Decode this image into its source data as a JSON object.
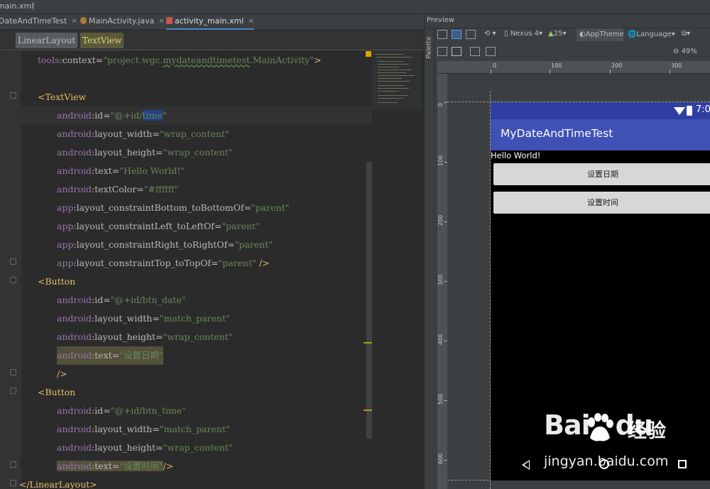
{
  "breadcrumb": {
    "file": "main.xml"
  },
  "tabs": [
    {
      "label": "DateAndTimeTest"
    },
    {
      "label": "MainActivity.java"
    },
    {
      "label": "activity_main.xml"
    }
  ],
  "xml_path": {
    "item1": "LinearLayout",
    "item2": "TextView"
  },
  "code": {
    "l0": {
      "ns": "tools",
      "attr": ":context=",
      "val": "\"project.wgc.",
      "val2": "mydateandtimetest",
      "val3": ".MainActivity\"",
      "close": ">"
    },
    "l1": {
      "tag": "<TextView"
    },
    "l2": {
      "ns": "android",
      "attr": ":id=",
      "val": "\"@+id/",
      "sel": "time",
      "end": "\""
    },
    "l3": {
      "ns": "android",
      "attr": ":layout_width=",
      "val": "\"wrap_content\""
    },
    "l4": {
      "ns": "android",
      "attr": ":layout_height=",
      "val": "\"wrap_content\""
    },
    "l5": {
      "ns": "android",
      "attr": ":text=",
      "val": "\"Hello World!\""
    },
    "l6": {
      "ns": "android",
      "attr": ":textColor=",
      "val": "\"#ffffff\""
    },
    "l7": {
      "ns": "app",
      "attr": ":layout_constraintBottom_toBottomOf=",
      "val": "\"parent\""
    },
    "l8": {
      "ns": "app",
      "attr": ":layout_constraintLeft_toLeftOf=",
      "val": "\"parent\""
    },
    "l9": {
      "ns": "app",
      "attr": ":layout_constraintRight_toRightOf=",
      "val": "\"parent\""
    },
    "l10": {
      "ns": "app",
      "attr": ":layout_constraintTop_toTopOf=",
      "val": "\"parent\"",
      "close": " />"
    },
    "l11": {
      "tag": "<Button"
    },
    "l12": {
      "ns": "android",
      "attr": ":id=",
      "val": "\"@+id/btn_date\""
    },
    "l13": {
      "ns": "android",
      "attr": ":layout_width=",
      "val": "\"match_parent\""
    },
    "l14": {
      "ns": "android",
      "attr": ":layout_height=",
      "val": "\"wrap_content\""
    },
    "l15": {
      "ns": "android",
      "attr": ":text=",
      "val": "\"设置日期\""
    },
    "l16": {
      "close": "/>"
    },
    "l17": {
      "tag": "<Button"
    },
    "l18": {
      "ns": "android",
      "attr": ":id=",
      "val": "\"@+id/btn_time\""
    },
    "l19": {
      "ns": "android",
      "attr": ":layout_width=",
      "val": "\"match_parent\""
    },
    "l20": {
      "ns": "android",
      "attr": ":layout_height=",
      "val": "\"wrap_content\""
    },
    "l21": {
      "ns": "android",
      "attr": ":text=",
      "val": "\"设置时间\"",
      "close": "/>"
    },
    "l22": {
      "tag": "</LinearLayout>"
    }
  },
  "preview": {
    "title": "Preview",
    "palette": "Palette",
    "device": "Nexus 4",
    "api": "25",
    "theme": "AppTheme",
    "language": "Language",
    "zoom": "49%",
    "ruler_x": [
      "0",
      "100",
      "200",
      "300"
    ],
    "ruler_y": [
      "0",
      "100",
      "200",
      "300",
      "400",
      "500",
      "600"
    ]
  },
  "phone": {
    "clock": "7:0",
    "app_title": "MyDateAndTimeTest",
    "hello": "Hello World!",
    "btn_date": "设置日期",
    "btn_time": "设置时间"
  },
  "watermark": {
    "logo": "Bai",
    "logo2": "du",
    "cn": "经验",
    "url": "jingyan.baidu.com"
  },
  "colors": {
    "accent": "#3f51b5",
    "status": "#303f9f",
    "tag": "#e8bf6a",
    "string": "#6a8759",
    "attr": "#9876aa"
  }
}
